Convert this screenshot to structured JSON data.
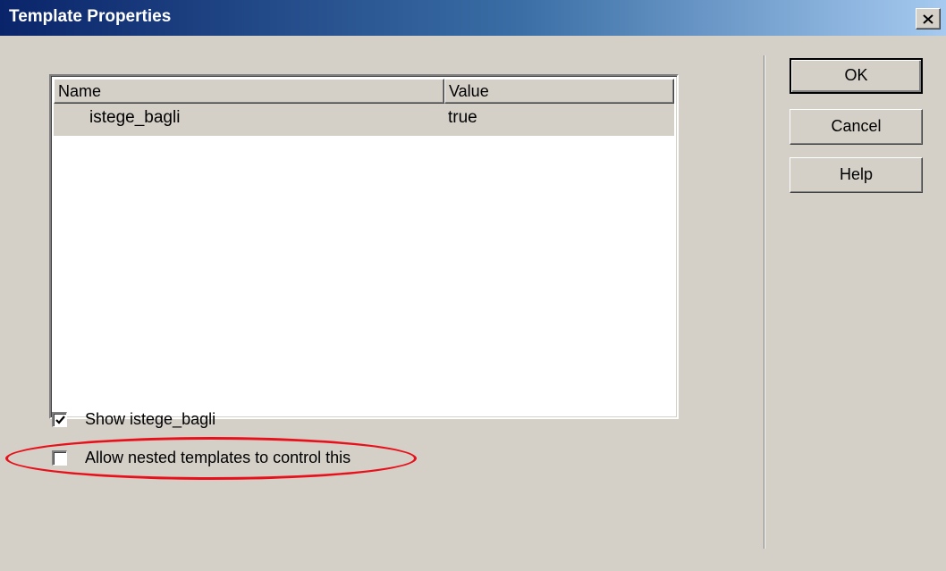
{
  "window": {
    "title": "Template Properties",
    "close_icon": "close-icon"
  },
  "parameters": {
    "columns": [
      "Name",
      "Value"
    ],
    "rows": [
      {
        "name": "istege_bagli",
        "value": "true"
      }
    ]
  },
  "options": {
    "show_label": "Show istege_bagli",
    "show_checked": true,
    "allow_nested_label": "Allow nested templates to control this",
    "allow_nested_checked": false
  },
  "buttons": {
    "ok": "OK",
    "cancel": "Cancel",
    "help": "Help"
  },
  "annotation": {
    "highlight_color": "#e8101a"
  }
}
